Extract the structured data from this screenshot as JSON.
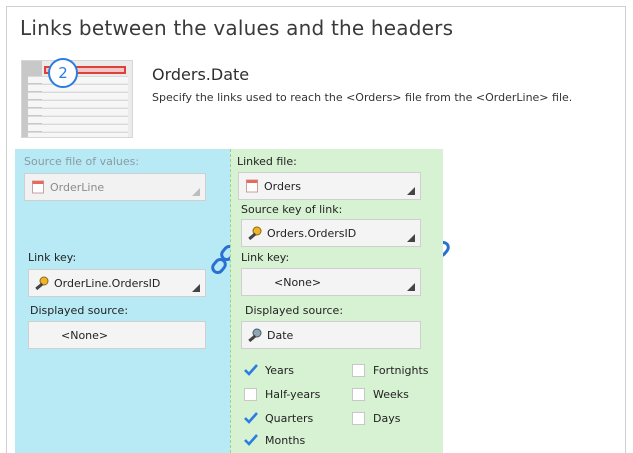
{
  "header": {
    "title": "Links between the values and the headers",
    "step_number": "2",
    "subtitle": "Orders.Date",
    "description": "Specify the links used to reach the <Orders> file from the <OrderLine> file."
  },
  "left_panel": {
    "source_label": "Source file of values:",
    "source_value": "OrderLine",
    "link_key_label": "Link key:",
    "link_key_value": "OrderLine.OrdersID",
    "displayed_source_label": "Displayed source:",
    "displayed_source_value": "<None>"
  },
  "right_panel": {
    "linked_file_label": "Linked file:",
    "linked_file_value": "Orders",
    "source_key_label": "Source key of link:",
    "source_key_value": "Orders.OrdersID",
    "link_key_label": "Link key:",
    "link_key_value": "<None>",
    "displayed_source_label": "Displayed source:",
    "displayed_source_value": "Date",
    "periods": {
      "years": {
        "label": "Years",
        "checked": true
      },
      "half_years": {
        "label": "Half-years",
        "checked": false
      },
      "quarters": {
        "label": "Quarters",
        "checked": true
      },
      "months": {
        "label": "Months",
        "checked": true
      },
      "fortnights": {
        "label": "Fortnights",
        "checked": false
      },
      "weeks": {
        "label": "Weeks",
        "checked": false
      },
      "days": {
        "label": "Days",
        "checked": false
      }
    }
  },
  "icons": {
    "file": "file-icon",
    "key": "key-icon",
    "date": "key-icon",
    "link": "chain-link-icon",
    "check": "checkmark-icon"
  },
  "colors": {
    "left_panel_bg": "#b8eaf6",
    "right_panel_bg": "#d7f2d2",
    "accent": "#2a7de1",
    "badge_border": "#2a7de1"
  }
}
